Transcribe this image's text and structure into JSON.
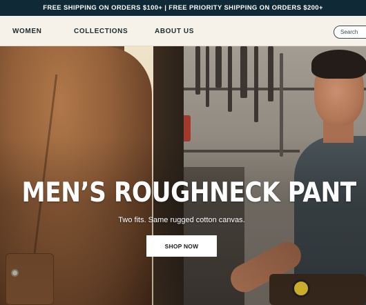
{
  "promo": {
    "text": "FREE SHIPPING ON ORDERS $100+ | FREE PRIORITY SHIPPING ON ORDERS $200+"
  },
  "nav": {
    "items": [
      {
        "label": "WOMEN"
      },
      {
        "label": "COLLECTIONS"
      },
      {
        "label": "ABOUT US"
      }
    ],
    "search": {
      "placeholder": "Search",
      "value": ""
    }
  },
  "hero": {
    "title": "MEN’S ROUGHNECK PANT",
    "subtitle": "Two fits. Same rugged cotton canvas.",
    "cta_label": "SHOP NOW"
  },
  "colors": {
    "promo_bg": "#0f2a36",
    "nav_bg": "#f6f1e9",
    "button_bg": "#ffffff",
    "hero_text": "#ffffff"
  }
}
